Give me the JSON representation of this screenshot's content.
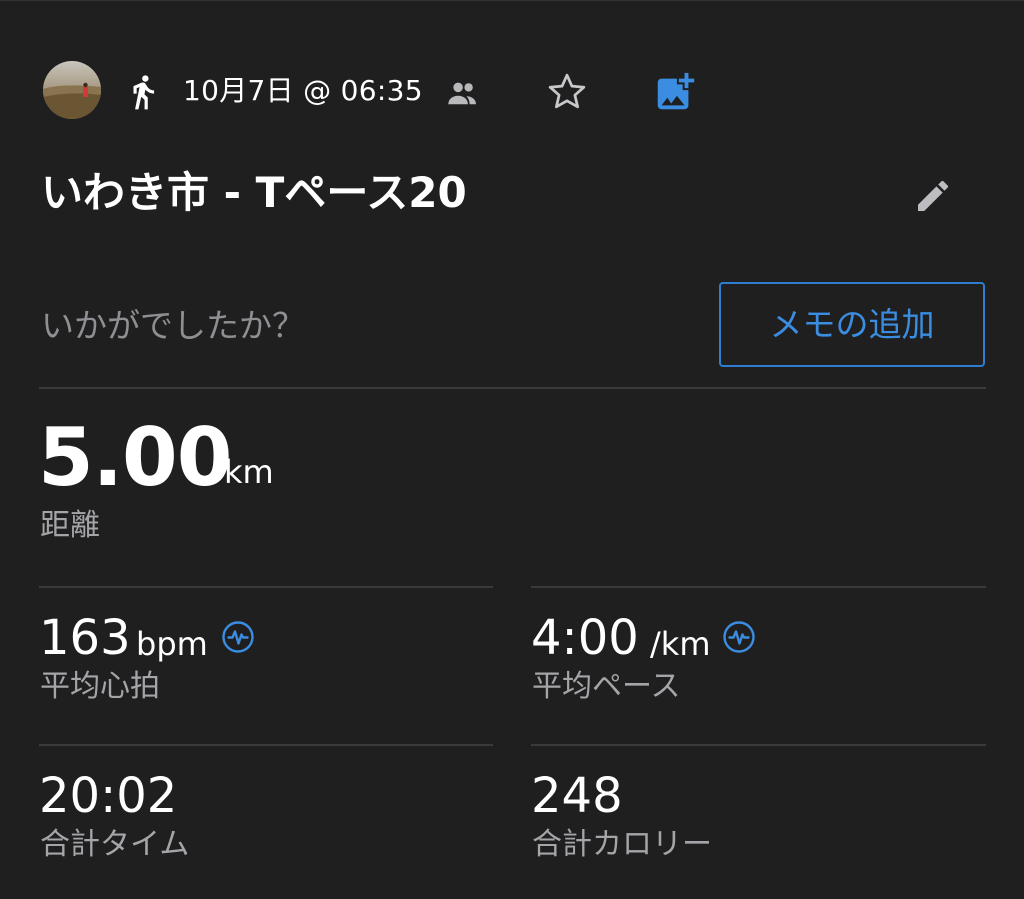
{
  "header": {
    "date_time": "10月7日 @ 06:35"
  },
  "activity": {
    "title": "いわき市 - Tペース20"
  },
  "notes": {
    "prompt": "いかがでしたか？",
    "add_memo_label": "メモの追加"
  },
  "distance": {
    "value": "5.00",
    "unit": "km",
    "label": "距離"
  },
  "stats": {
    "avg_hr": {
      "value": "163",
      "unit": "bpm",
      "label": "平均心拍"
    },
    "avg_pace": {
      "value": "4:00",
      "unit": "/km",
      "label": "平均ペース"
    },
    "total_time": {
      "value": "20:02",
      "label": "合計タイム"
    },
    "calories": {
      "value": "248",
      "label": "合計カロリー"
    }
  },
  "icons": {
    "activity_type": "running-icon",
    "social": "people-icon",
    "favorite": "star-icon",
    "add_photo": "add-photo-icon",
    "edit": "pencil-icon",
    "sensor": "heart-rate-sensor-icon"
  },
  "colors": {
    "background": "#1f1f20",
    "accent": "#3a8de0",
    "text_primary": "#ffffff",
    "text_secondary": "#a5a5a9"
  }
}
